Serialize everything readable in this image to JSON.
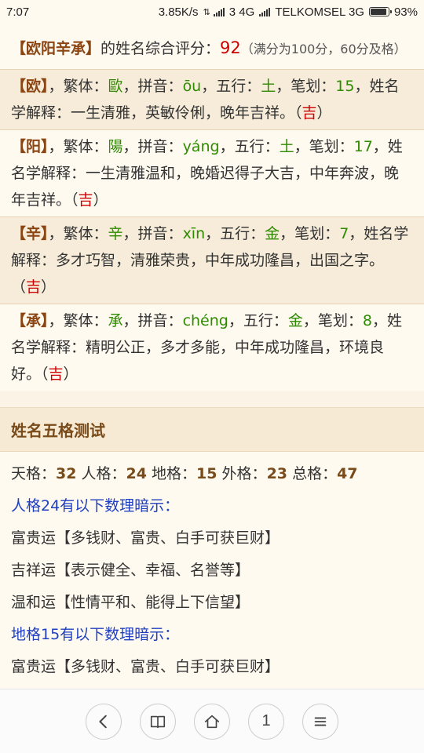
{
  "status_bar": {
    "time": "7:07",
    "speed": "3.85K/s",
    "sim_info": "3 4G",
    "carrier": "TELKOMSEL 3G",
    "battery": "93%",
    "battery_level": 0.93
  },
  "summary": {
    "name_bracket": "【欧阳辛承】",
    "text": "的姓名综合评分：",
    "score": "92",
    "note": "（满分为100分，60分及格）"
  },
  "characters": [
    {
      "bracket": "【欧】",
      "p1": "，繁体：",
      "trad": "歐",
      "p2": "，拼音：",
      "pinyin": "ōu",
      "p3": "，五行：",
      "element": "土",
      "p4": "，笔划：",
      "strokes": "15",
      "p5": "，姓名学解释：一生清雅，英敏伶俐，晚年吉祥。（",
      "luck": "吉",
      "p6": "）"
    },
    {
      "bracket": "【阳】",
      "p1": "，繁体：",
      "trad": "陽",
      "p2": "，拼音：",
      "pinyin": "yáng",
      "p3": "，五行：",
      "element": "土",
      "p4": "，笔划：",
      "strokes": "17",
      "p5": "，姓名学解释：一生清雅温和，晚婚迟得子大吉，中年奔波，晚年吉祥。（",
      "luck": "吉",
      "p6": "）"
    },
    {
      "bracket": "【辛】",
      "p1": "，繁体：",
      "trad": "辛",
      "p2": "，拼音：",
      "pinyin": "xīn",
      "p3": "，五行：",
      "element": "金",
      "p4": "，笔划：",
      "strokes": "7",
      "p5": "，姓名学解释：多才巧智，清雅荣贵，中年成功隆昌，出国之字。（",
      "luck": "吉",
      "p6": "）"
    },
    {
      "bracket": "【承】",
      "p1": "，繁体：",
      "trad": "承",
      "p2": "，拼音：",
      "pinyin": "chéng",
      "p3": "，五行：",
      "element": "金",
      "p4": "，笔划：",
      "strokes": "8",
      "p5": "，姓名学解释：精明公正，多才多能，中年成功隆昌，环境良好。（",
      "luck": "吉",
      "p6": "）"
    }
  ],
  "wuge": {
    "header": "姓名五格测试",
    "tian_label": "天格：",
    "tian": "32",
    "ren_label": "人格：",
    "ren": "24",
    "di_label": "地格：",
    "di": "15",
    "wai_label": "外格：",
    "wai": "23",
    "zong_label": "总格：",
    "zong": "47",
    "ren_hint": "人格24有以下数理暗示：",
    "ren_items": [
      "富贵运【多钱财、富贵、白手可获巨财】",
      "吉祥运【表示健全、幸福、名誉等】",
      "温和运【性情平和、能得上下信望】"
    ],
    "di_hint": "地格15有以下数理暗示：",
    "di_items": [
      "富贵运【多钱财、富贵、白手可获巨财】"
    ]
  },
  "bottom_nav": {
    "tab_count": "1",
    "icons": [
      "back-icon",
      "book-icon",
      "home-icon",
      "tab-count",
      "menu-icon"
    ]
  },
  "colors": {
    "background": "#fffaf0",
    "bracket": "#8b4513",
    "score": "#cc0000",
    "element": "#2e8b00",
    "luck": "#cc0000",
    "hint": "#1f3fbf",
    "section_header": "#f7ead4"
  }
}
